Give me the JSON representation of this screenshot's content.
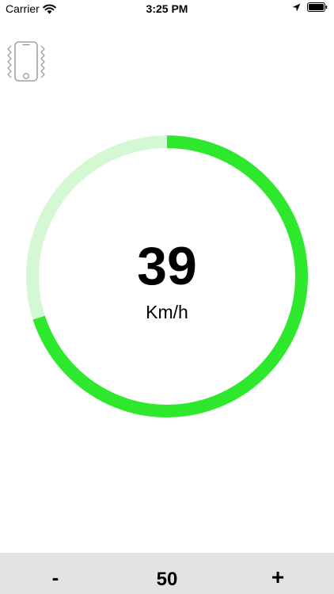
{
  "status_bar": {
    "carrier": "Carrier",
    "time": "3:25 PM",
    "icons": [
      "wifi-icon",
      "location-arrow-icon",
      "battery-icon"
    ]
  },
  "vibrate": {
    "icon": "phone-vibrate-icon"
  },
  "gauge": {
    "speed": "39",
    "unit": "Km/h",
    "fill_fraction": 0.7,
    "colors": {
      "active": "#2ee82e",
      "track": "#d3f8d3"
    }
  },
  "controls": {
    "minus_label": "-",
    "limit_value": "50",
    "plus_label": "+",
    "bar_color": "#e3e3e3"
  }
}
